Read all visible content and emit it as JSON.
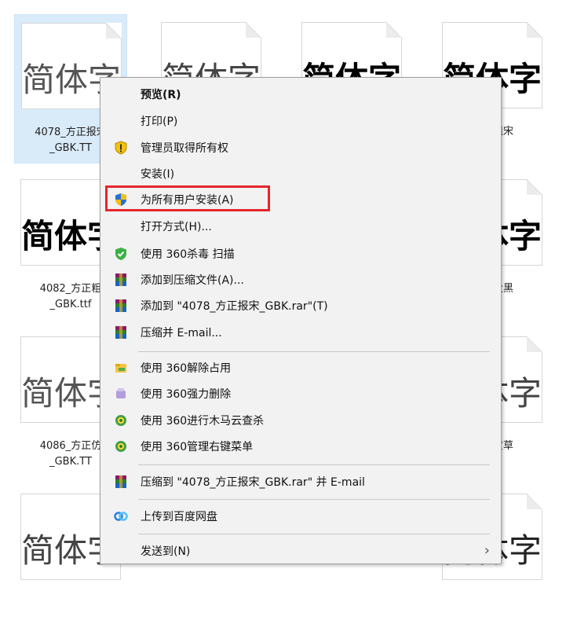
{
  "files": [
    {
      "glyph": "简体字",
      "name": "4078_方正报宋\n_GBK.TT"
    },
    {
      "glyph": "简体字",
      "name": ""
    },
    {
      "glyph": "简体字",
      "name": ""
    },
    {
      "glyph": "简体字",
      "name": "正粗宋\n.ttf"
    },
    {
      "glyph": "简体字",
      "name": "4082_方正粗\n_GBK.ttf"
    },
    {
      "glyph": "简体字",
      "name": "正大黑\n.ttf"
    },
    {
      "glyph": "简体字",
      "name": "4086_方正仿\n_GBK.TT"
    },
    {
      "glyph": "简体字",
      "name": "正黄草\n.ttf"
    },
    {
      "glyph": "简体字",
      "name": ""
    },
    {
      "glyph": "简体字",
      "name": ""
    }
  ],
  "menu": {
    "items": [
      {
        "label": "预览(R)",
        "icon": ""
      },
      {
        "label": "打印(P)",
        "icon": ""
      },
      {
        "label": "管理员取得所有权",
        "icon": "shield-yellow-icon"
      },
      {
        "label": "安装(I)",
        "icon": ""
      },
      {
        "label": "为所有用户安装(A)",
        "icon": "uac-shield-icon"
      },
      {
        "label": "打开方式(H)...",
        "icon": ""
      },
      {
        "label": "使用 360杀毒 扫描",
        "icon": "360-antivirus-icon"
      },
      {
        "label": "添加到压缩文件(A)...",
        "icon": "winrar-icon"
      },
      {
        "label": "添加到 \"4078_方正报宋_GBK.rar\"(T)",
        "icon": "winrar-icon"
      },
      {
        "label": "压缩并 E-mail...",
        "icon": "winrar-icon"
      },
      {
        "label": "使用 360解除占用",
        "icon": "360-unlock-icon"
      },
      {
        "label": "使用 360强力删除",
        "icon": "360-delete-icon"
      },
      {
        "label": "使用 360进行木马云查杀",
        "icon": "360-trojan-icon"
      },
      {
        "label": "使用 360管理右键菜单",
        "icon": "360-menu-icon"
      },
      {
        "label": "压缩到 \"4078_方正报宋_GBK.rar\" 并 E-mail",
        "icon": "winrar-icon"
      },
      {
        "label": "上传到百度网盘",
        "icon": "baidu-netdisk-icon"
      },
      {
        "label": "发送到(N)",
        "icon": ""
      }
    ],
    "submenu_arrow": "›"
  }
}
